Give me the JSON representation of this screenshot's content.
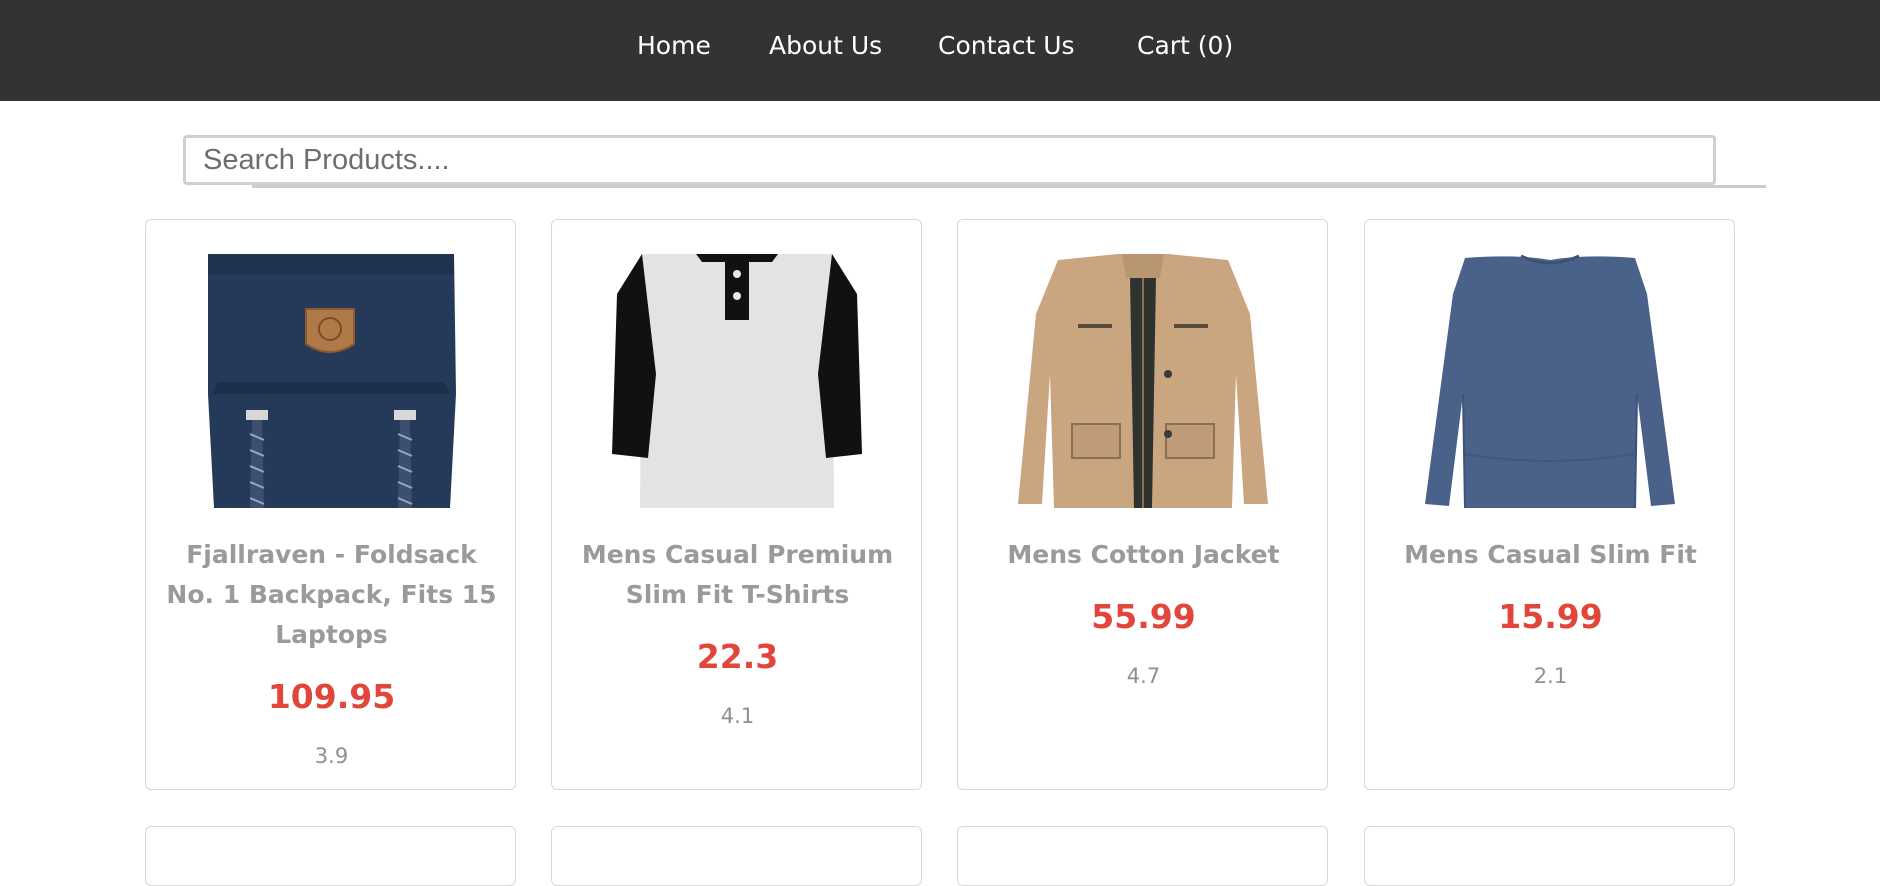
{
  "nav": {
    "home": "Home",
    "about": "About Us",
    "contact": "Contact Us",
    "cart": "Cart (0)"
  },
  "search": {
    "placeholder": "Search Products....",
    "value": ""
  },
  "products": [
    {
      "title": "Fjallraven - Foldsack No. 1 Backpack, Fits 15 Laptops",
      "price": "109.95",
      "rating": "3.9",
      "image": "navy-backpack"
    },
    {
      "title": "Mens Casual Premium Slim Fit T-Shirts",
      "price": "22.3",
      "rating": "4.1",
      "image": "raglan-tshirt"
    },
    {
      "title": "Mens Cotton Jacket",
      "price": "55.99",
      "rating": "4.7",
      "image": "khaki-jacket"
    },
    {
      "title": "Mens Casual Slim Fit",
      "price": "15.99",
      "rating": "2.1",
      "image": "blue-longsleeve"
    }
  ],
  "colors": {
    "navbar": "#333333",
    "price": "#e2463a",
    "title": "#9a9a9a"
  }
}
